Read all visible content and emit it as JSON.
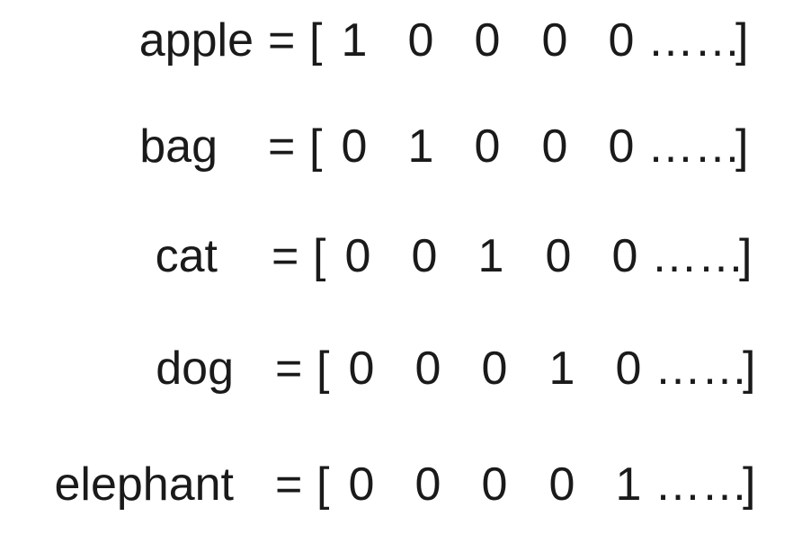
{
  "rows": [
    {
      "word": "apple",
      "eq": "=",
      "lbr": "[",
      "v": [
        "1",
        "0",
        "0",
        "0",
        "0"
      ],
      "dots": "……",
      "rbr": "]"
    },
    {
      "word": "bag",
      "eq": "=",
      "lbr": "[",
      "v": [
        "0",
        "1",
        "0",
        "0",
        "0"
      ],
      "dots": "……",
      "rbr": "]"
    },
    {
      "word": "cat",
      "eq": "=",
      "lbr": "[",
      "v": [
        "0",
        "0",
        "1",
        "0",
        "0"
      ],
      "dots": "……",
      "rbr": "]"
    },
    {
      "word": "dog",
      "eq": "=",
      "lbr": "[",
      "v": [
        "0",
        "0",
        "0",
        "1",
        "0"
      ],
      "dots": "……",
      "rbr": "]"
    },
    {
      "word": "elephant",
      "eq": "=",
      "lbr": "[",
      "v": [
        "0",
        "0",
        "0",
        "0",
        "1"
      ],
      "dots": "……",
      "rbr": "]"
    }
  ],
  "colors": {
    "text": "#1a1a1a",
    "background": "#ffffff"
  }
}
